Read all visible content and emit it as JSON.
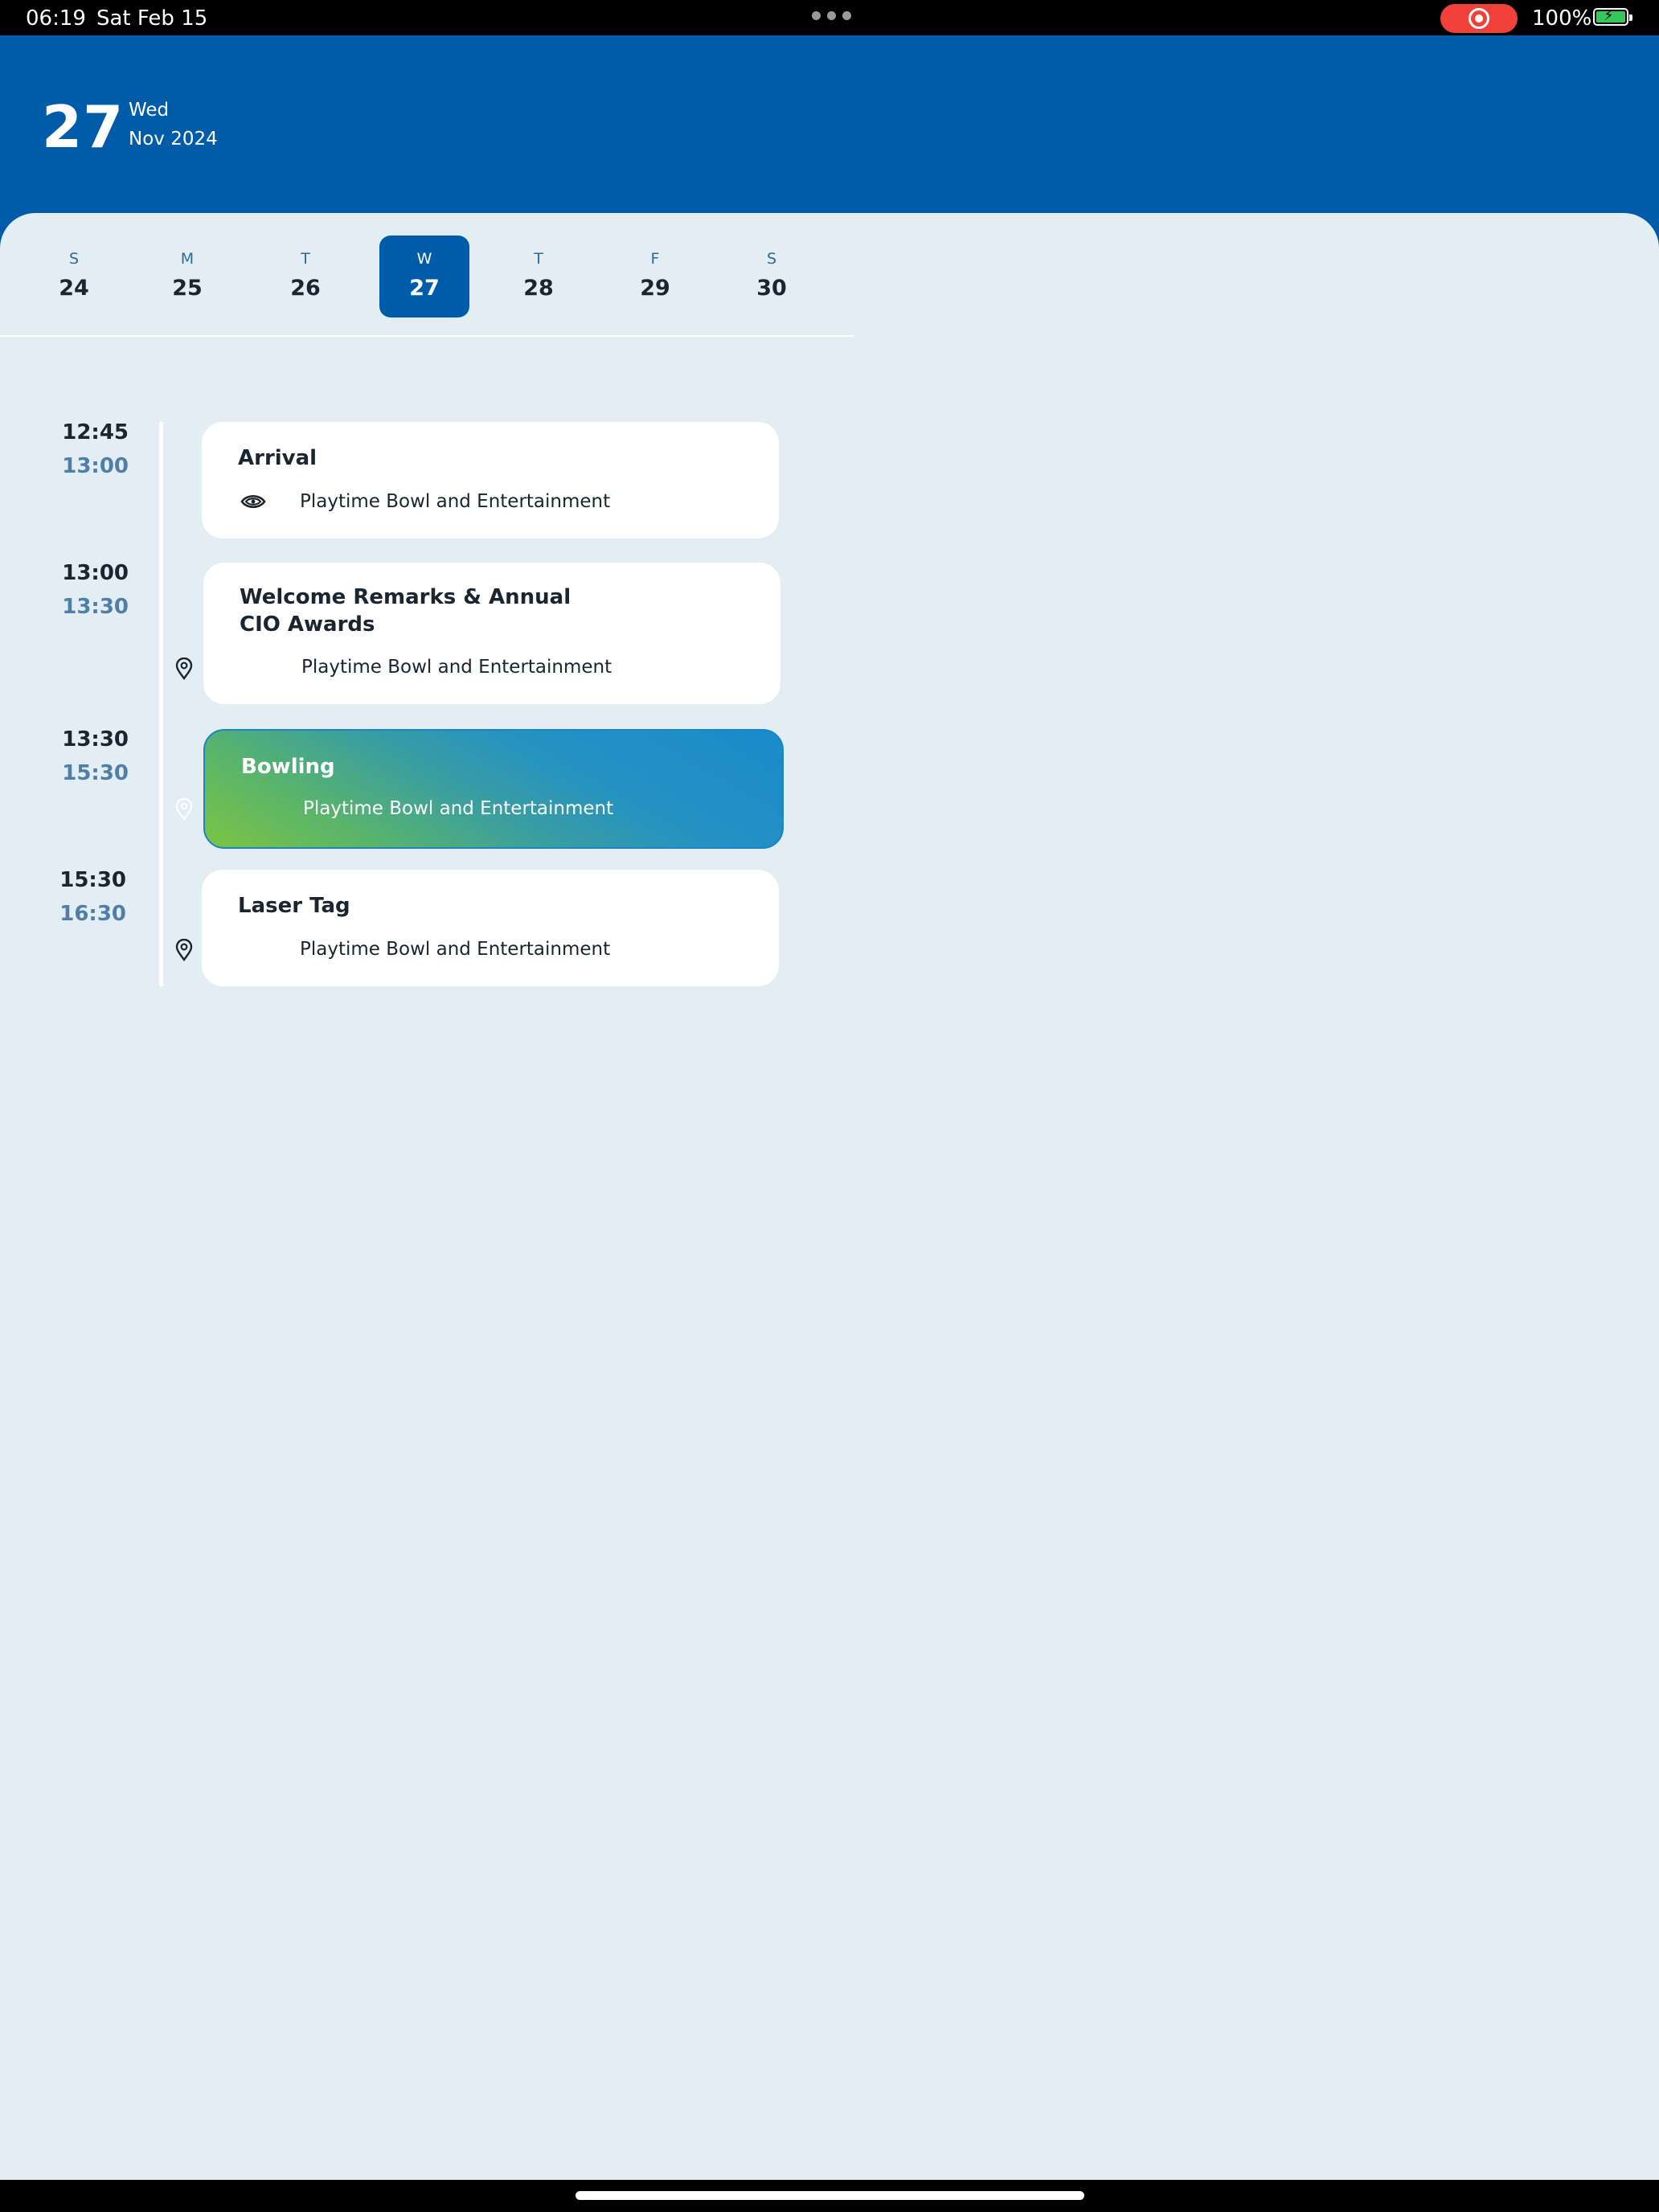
{
  "status_bar": {
    "time": "06:19",
    "date": "Sat Feb 15",
    "battery": "100%"
  },
  "header": {
    "day": "27",
    "weekday": "Wed",
    "month_year": "Nov 2024"
  },
  "week": [
    {
      "letter": "S",
      "num": "24"
    },
    {
      "letter": "M",
      "num": "25"
    },
    {
      "letter": "T",
      "num": "26"
    },
    {
      "letter": "W",
      "num": "27",
      "selected": true
    },
    {
      "letter": "T",
      "num": "28"
    },
    {
      "letter": "F",
      "num": "29"
    },
    {
      "letter": "S",
      "num": "30"
    }
  ],
  "events": [
    {
      "start": "12:45",
      "end": "13:00",
      "title": "Arrival",
      "location": "Playtime Bowl and Entertainment",
      "icon": "eye-icon"
    },
    {
      "start": "13:00",
      "end": "13:30",
      "title": "Welcome Remarks & Annual CIO Awards",
      "location": "Playtime Bowl and Entertainment",
      "icon": "location-pin-icon"
    },
    {
      "start": "13:30",
      "end": "15:30",
      "title": "Bowling",
      "location": "Playtime Bowl and Entertainment",
      "icon": "location-pin-icon",
      "highlighted": true
    },
    {
      "start": "15:30",
      "end": "16:30",
      "title": "Laser Tag",
      "location": "Playtime Bowl and Entertainment",
      "icon": "location-pin-icon"
    }
  ],
  "colors": {
    "header_blue": "#005ca9",
    "background": "#e2edf4",
    "highlight_gradient_start": "#7cc443",
    "highlight_gradient_end": "#1a8bcb",
    "end_time": "#4f7fa6"
  }
}
